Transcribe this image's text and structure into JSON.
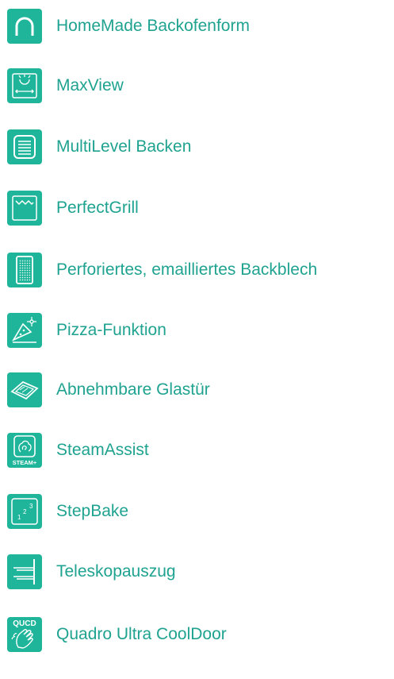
{
  "accent_color": "#1fb59a",
  "text_color": "#1fa390",
  "features": [
    {
      "label": "HomeMade Backofenform",
      "icon": "oven-dome-icon"
    },
    {
      "label": "MaxView",
      "icon": "wide-view-light-icon"
    },
    {
      "label": "MultiLevel Backen",
      "icon": "multi-level-icon"
    },
    {
      "label": "PerfectGrill",
      "icon": "grill-icon"
    },
    {
      "label": "Perforiertes, emailliertes Backblech",
      "icon": "perforated-tray-icon"
    },
    {
      "label": "Pizza-Funktion",
      "icon": "pizza-icon"
    },
    {
      "label": "Abnehmbare Glastür",
      "icon": "glass-door-icon"
    },
    {
      "label": "SteamAssist",
      "icon": "steam-assist-icon",
      "icon_text": "STEAM+"
    },
    {
      "label": "StepBake",
      "icon": "step-bake-icon",
      "icon_text": "1 2 3"
    },
    {
      "label": "Teleskopauszug",
      "icon": "telescopic-rails-icon"
    },
    {
      "label": "Quadro Ultra CoolDoor",
      "icon": "cool-door-icon",
      "icon_text": "QUCD"
    }
  ]
}
